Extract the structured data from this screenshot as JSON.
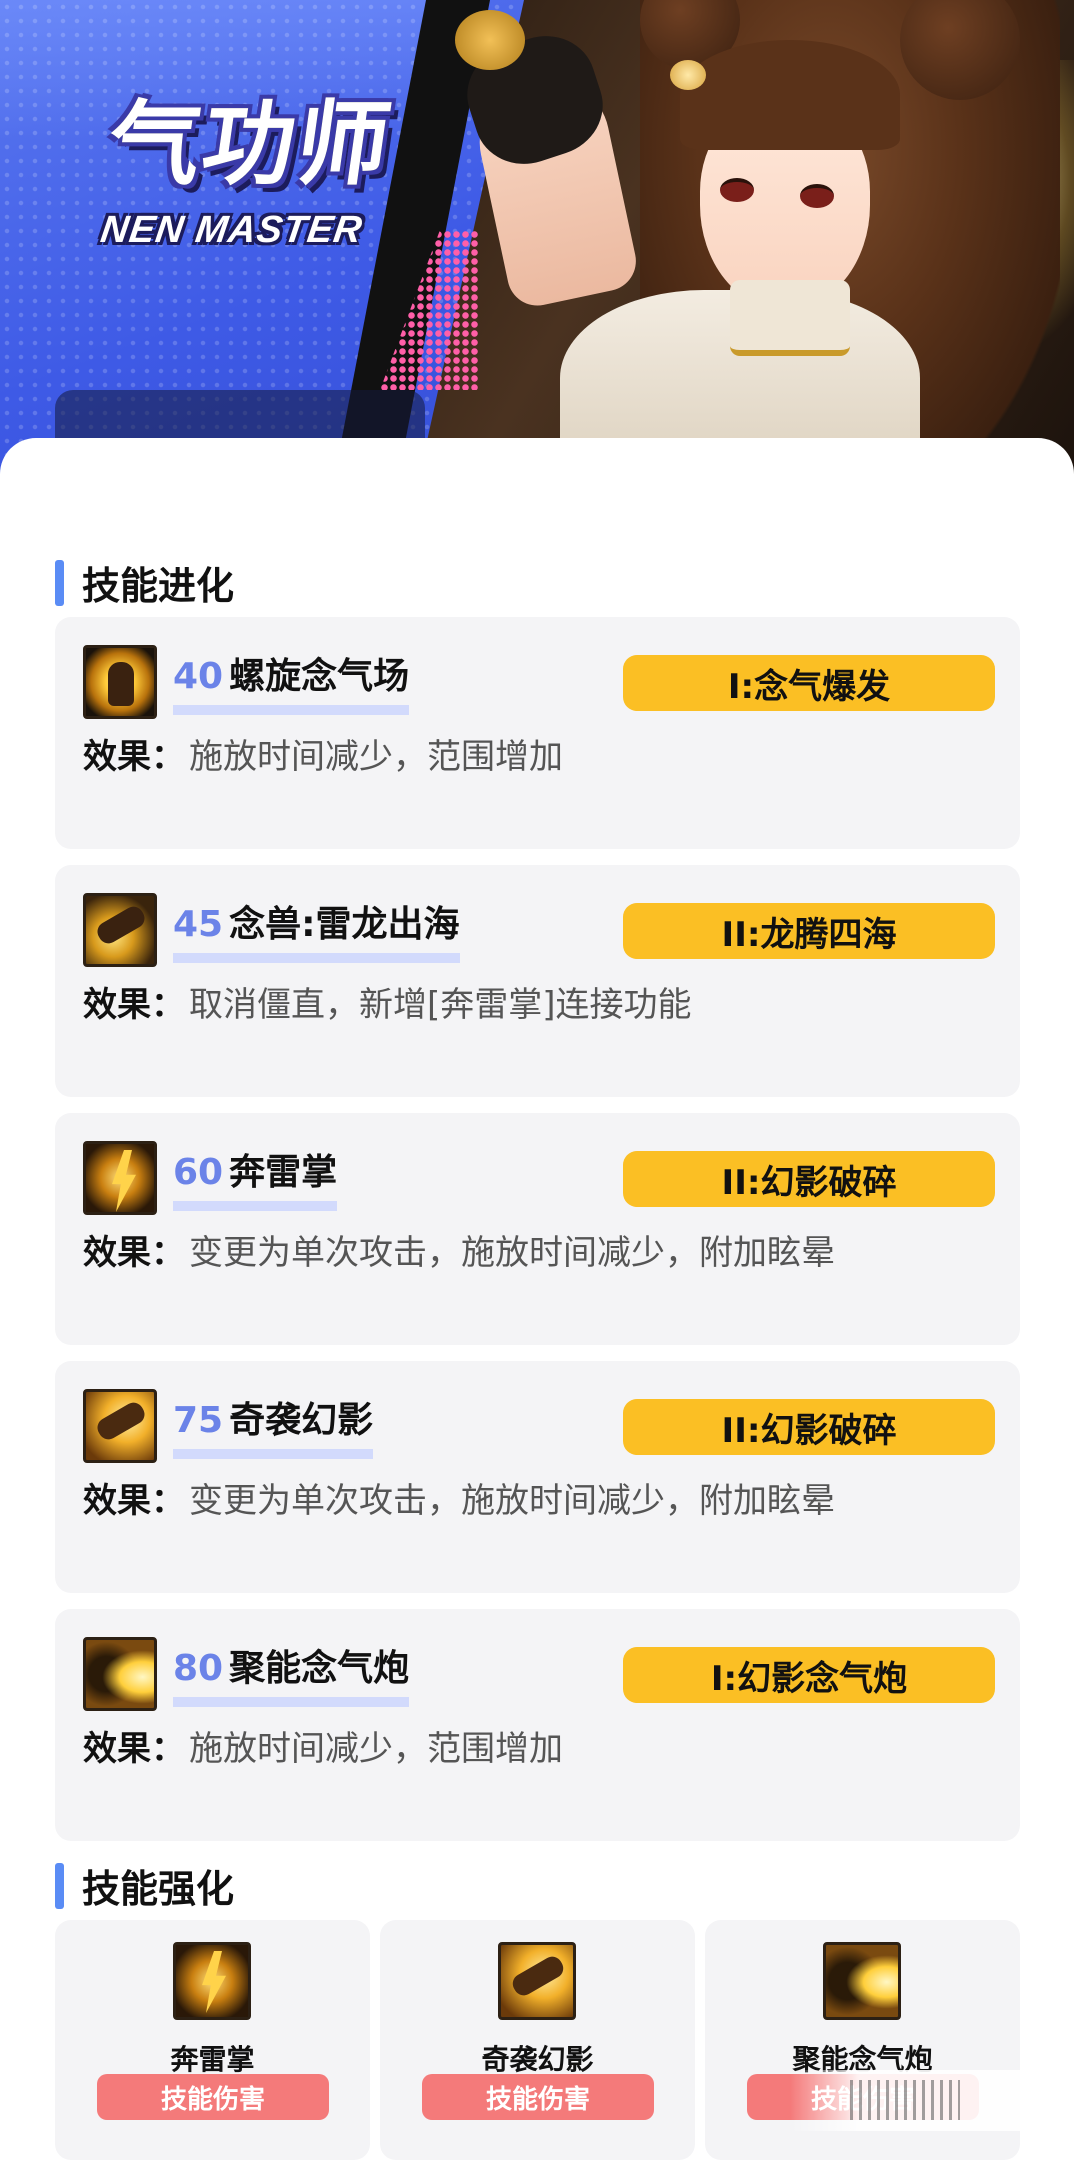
{
  "hero": {
    "title_cn": "气功师",
    "title_en": "NEN MASTER"
  },
  "section_evolution": {
    "title": "技能进化"
  },
  "skills": [
    {
      "level": "40",
      "name": "螺旋念气场",
      "badge": "I:念气爆发",
      "effect_label": "效果：",
      "effect": "施放时间减少，范围增加",
      "icon": "nen-aura-icon"
    },
    {
      "level": "45",
      "name": "念兽:雷龙出海",
      "badge": "II:龙腾四海",
      "effect_label": "效果：",
      "effect": "取消僵直，新增[奔雷掌]连接功能",
      "icon": "thunder-dragon-icon"
    },
    {
      "level": "60",
      "name": "奔雷掌",
      "badge": "II:幻影破碎",
      "effect_label": "效果：",
      "effect": "变更为单次攻击，施放时间减少，附加眩晕",
      "icon": "thunder-palm-icon"
    },
    {
      "level": "75",
      "name": "奇袭幻影",
      "badge": "II:幻影破碎",
      "effect_label": "效果：",
      "effect": "变更为单次攻击，施放时间减少，附加眩晕",
      "icon": "phantom-strike-icon"
    },
    {
      "level": "80",
      "name": "聚能念气炮",
      "badge": "I:幻影念气炮",
      "effect_label": "效果：",
      "effect": "施放时间减少，范围增加",
      "icon": "nen-cannon-icon"
    }
  ],
  "section_enhance": {
    "title": "技能强化"
  },
  "enhancements": [
    {
      "name": "奔雷掌",
      "tag": "技能伤害",
      "icon": "thunder-palm-icon"
    },
    {
      "name": "奇袭幻影",
      "tag": "技能伤害",
      "icon": "phantom-strike-icon"
    },
    {
      "name": "聚能念气炮",
      "tag": "技能伤害",
      "icon": "nen-cannon-icon"
    }
  ],
  "colors": {
    "hero_blue": "#3e5ae6",
    "section_bar": "#5a8cf5",
    "level_number": "#6b83e8",
    "badge": "#fbbf24",
    "tag": "#f47a7a",
    "card_bg": "#f4f4f6"
  }
}
